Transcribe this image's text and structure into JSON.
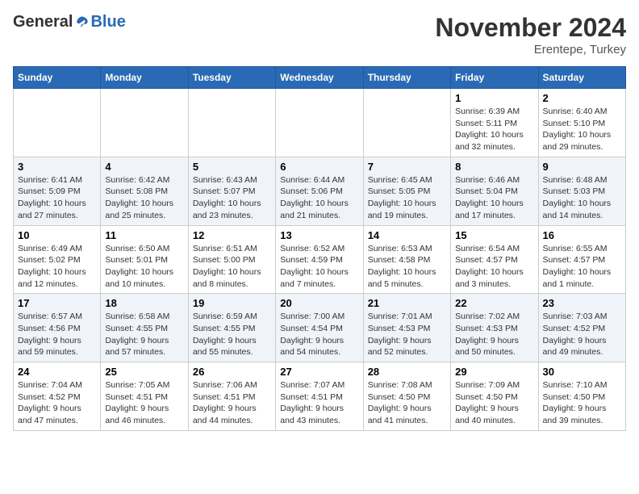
{
  "header": {
    "logo_general": "General",
    "logo_blue": "Blue",
    "month_title": "November 2024",
    "location": "Erentepe, Turkey"
  },
  "weekdays": [
    "Sunday",
    "Monday",
    "Tuesday",
    "Wednesday",
    "Thursday",
    "Friday",
    "Saturday"
  ],
  "weeks": [
    [
      {
        "day": "",
        "info": ""
      },
      {
        "day": "",
        "info": ""
      },
      {
        "day": "",
        "info": ""
      },
      {
        "day": "",
        "info": ""
      },
      {
        "day": "",
        "info": ""
      },
      {
        "day": "1",
        "info": "Sunrise: 6:39 AM\nSunset: 5:11 PM\nDaylight: 10 hours\nand 32 minutes."
      },
      {
        "day": "2",
        "info": "Sunrise: 6:40 AM\nSunset: 5:10 PM\nDaylight: 10 hours\nand 29 minutes."
      }
    ],
    [
      {
        "day": "3",
        "info": "Sunrise: 6:41 AM\nSunset: 5:09 PM\nDaylight: 10 hours\nand 27 minutes."
      },
      {
        "day": "4",
        "info": "Sunrise: 6:42 AM\nSunset: 5:08 PM\nDaylight: 10 hours\nand 25 minutes."
      },
      {
        "day": "5",
        "info": "Sunrise: 6:43 AM\nSunset: 5:07 PM\nDaylight: 10 hours\nand 23 minutes."
      },
      {
        "day": "6",
        "info": "Sunrise: 6:44 AM\nSunset: 5:06 PM\nDaylight: 10 hours\nand 21 minutes."
      },
      {
        "day": "7",
        "info": "Sunrise: 6:45 AM\nSunset: 5:05 PM\nDaylight: 10 hours\nand 19 minutes."
      },
      {
        "day": "8",
        "info": "Sunrise: 6:46 AM\nSunset: 5:04 PM\nDaylight: 10 hours\nand 17 minutes."
      },
      {
        "day": "9",
        "info": "Sunrise: 6:48 AM\nSunset: 5:03 PM\nDaylight: 10 hours\nand 14 minutes."
      }
    ],
    [
      {
        "day": "10",
        "info": "Sunrise: 6:49 AM\nSunset: 5:02 PM\nDaylight: 10 hours\nand 12 minutes."
      },
      {
        "day": "11",
        "info": "Sunrise: 6:50 AM\nSunset: 5:01 PM\nDaylight: 10 hours\nand 10 minutes."
      },
      {
        "day": "12",
        "info": "Sunrise: 6:51 AM\nSunset: 5:00 PM\nDaylight: 10 hours\nand 8 minutes."
      },
      {
        "day": "13",
        "info": "Sunrise: 6:52 AM\nSunset: 4:59 PM\nDaylight: 10 hours\nand 7 minutes."
      },
      {
        "day": "14",
        "info": "Sunrise: 6:53 AM\nSunset: 4:58 PM\nDaylight: 10 hours\nand 5 minutes."
      },
      {
        "day": "15",
        "info": "Sunrise: 6:54 AM\nSunset: 4:57 PM\nDaylight: 10 hours\nand 3 minutes."
      },
      {
        "day": "16",
        "info": "Sunrise: 6:55 AM\nSunset: 4:57 PM\nDaylight: 10 hours\nand 1 minute."
      }
    ],
    [
      {
        "day": "17",
        "info": "Sunrise: 6:57 AM\nSunset: 4:56 PM\nDaylight: 9 hours\nand 59 minutes."
      },
      {
        "day": "18",
        "info": "Sunrise: 6:58 AM\nSunset: 4:55 PM\nDaylight: 9 hours\nand 57 minutes."
      },
      {
        "day": "19",
        "info": "Sunrise: 6:59 AM\nSunset: 4:55 PM\nDaylight: 9 hours\nand 55 minutes."
      },
      {
        "day": "20",
        "info": "Sunrise: 7:00 AM\nSunset: 4:54 PM\nDaylight: 9 hours\nand 54 minutes."
      },
      {
        "day": "21",
        "info": "Sunrise: 7:01 AM\nSunset: 4:53 PM\nDaylight: 9 hours\nand 52 minutes."
      },
      {
        "day": "22",
        "info": "Sunrise: 7:02 AM\nSunset: 4:53 PM\nDaylight: 9 hours\nand 50 minutes."
      },
      {
        "day": "23",
        "info": "Sunrise: 7:03 AM\nSunset: 4:52 PM\nDaylight: 9 hours\nand 49 minutes."
      }
    ],
    [
      {
        "day": "24",
        "info": "Sunrise: 7:04 AM\nSunset: 4:52 PM\nDaylight: 9 hours\nand 47 minutes."
      },
      {
        "day": "25",
        "info": "Sunrise: 7:05 AM\nSunset: 4:51 PM\nDaylight: 9 hours\nand 46 minutes."
      },
      {
        "day": "26",
        "info": "Sunrise: 7:06 AM\nSunset: 4:51 PM\nDaylight: 9 hours\nand 44 minutes."
      },
      {
        "day": "27",
        "info": "Sunrise: 7:07 AM\nSunset: 4:51 PM\nDaylight: 9 hours\nand 43 minutes."
      },
      {
        "day": "28",
        "info": "Sunrise: 7:08 AM\nSunset: 4:50 PM\nDaylight: 9 hours\nand 41 minutes."
      },
      {
        "day": "29",
        "info": "Sunrise: 7:09 AM\nSunset: 4:50 PM\nDaylight: 9 hours\nand 40 minutes."
      },
      {
        "day": "30",
        "info": "Sunrise: 7:10 AM\nSunset: 4:50 PM\nDaylight: 9 hours\nand 39 minutes."
      }
    ]
  ]
}
